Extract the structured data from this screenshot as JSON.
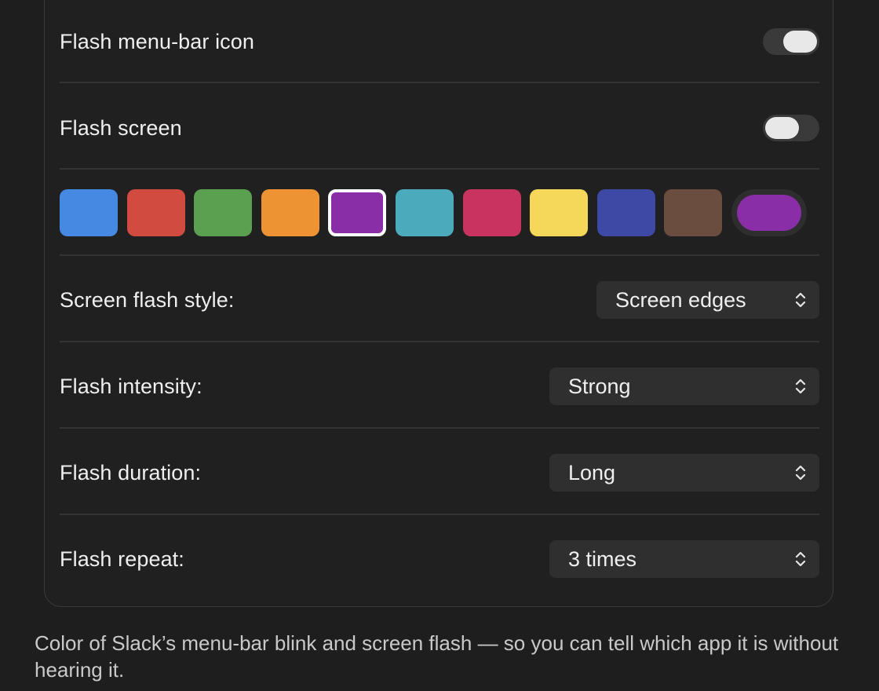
{
  "settings": {
    "flash_menu_bar_icon": {
      "label": "Flash menu-bar icon",
      "on": true
    },
    "flash_screen": {
      "label": "Flash screen",
      "on": false
    },
    "colors": {
      "swatches": [
        "#4589e2",
        "#d24b40",
        "#5aa050",
        "#ee9334",
        "#8a2ea8",
        "#4babbd",
        "#c8335f",
        "#f5d75a",
        "#3d49a4",
        "#6b4d40"
      ],
      "selected_index": 4,
      "custom_color": "#8a2ea8"
    },
    "screen_flash_style": {
      "label": "Screen flash style:",
      "value": "Screen edges"
    },
    "flash_intensity": {
      "label": "Flash intensity:",
      "value": "Strong"
    },
    "flash_duration": {
      "label": "Flash duration:",
      "value": "Long"
    },
    "flash_repeat": {
      "label": "Flash repeat:",
      "value": "3 times"
    }
  },
  "footer": {
    "text": "Color of Slack’s menu-bar blink and screen flash — so you can tell which app it is without hearing it."
  }
}
